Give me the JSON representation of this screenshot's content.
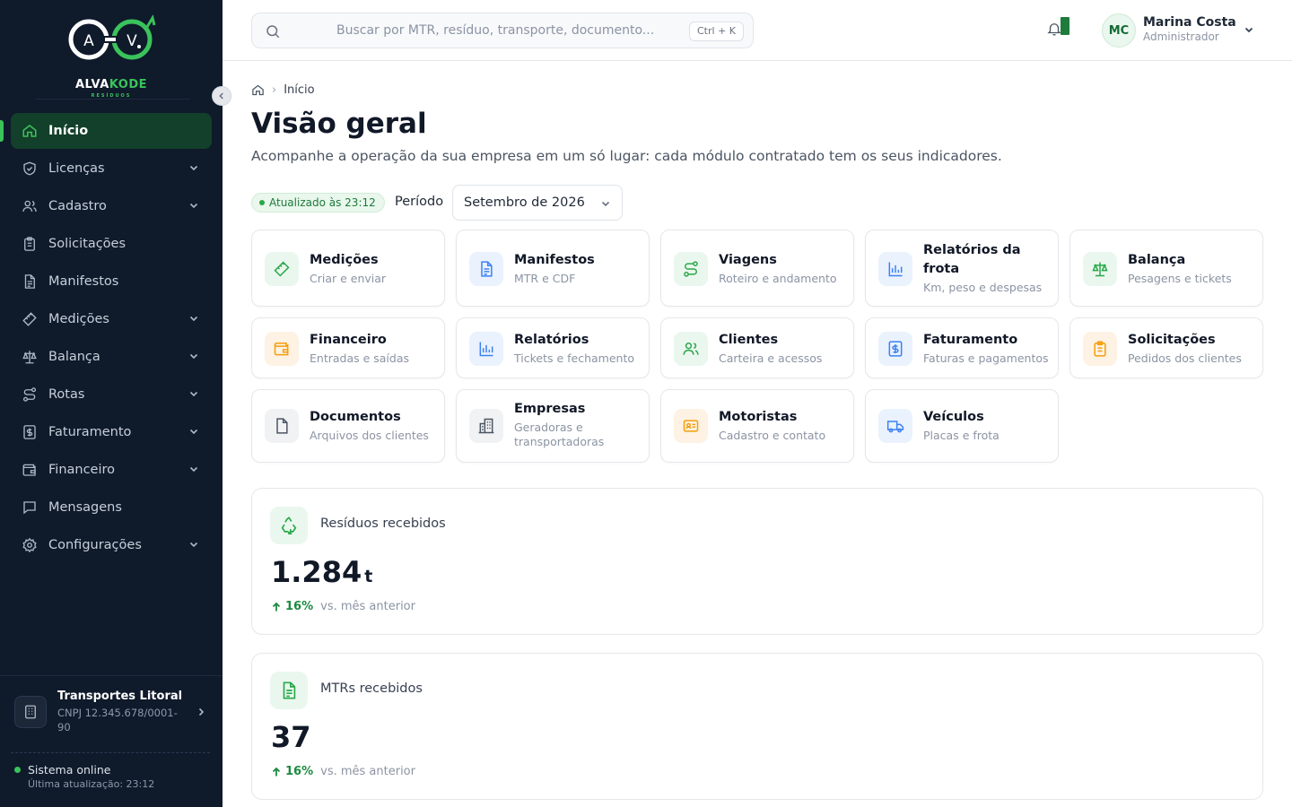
{
  "brand": {
    "name_part1": "ALVA",
    "name_part2": "KODE",
    "sub": "RESÍDUOS",
    "accent": "#3ac35a"
  },
  "sidebar": {
    "items": [
      {
        "label": "Início",
        "icon": "home-icon",
        "active": true,
        "has_children": false
      },
      {
        "label": "Licenças",
        "icon": "shield-icon",
        "has_children": true
      },
      {
        "label": "Cadastro",
        "icon": "users-icon",
        "has_children": true
      },
      {
        "label": "Solicitações",
        "icon": "clipboard-icon",
        "has_children": false
      },
      {
        "label": "Manifestos",
        "icon": "document-icon",
        "has_children": false
      },
      {
        "label": "Medições",
        "icon": "ruler-icon",
        "has_children": true
      },
      {
        "label": "Balança",
        "icon": "scale-icon",
        "has_children": true
      },
      {
        "label": "Rotas",
        "icon": "route-icon",
        "has_children": true
      },
      {
        "label": "Faturamento",
        "icon": "invoice-icon",
        "has_children": true
      },
      {
        "label": "Financeiro",
        "icon": "wallet-icon",
        "has_children": true
      },
      {
        "label": "Mensagens",
        "icon": "message-icon",
        "has_children": false
      },
      {
        "label": "Configurações",
        "icon": "gear-icon",
        "has_children": true
      }
    ],
    "company": {
      "name": "Transportes Litoral",
      "cnpj": "CNPJ 12.345.678/0001-90"
    },
    "status": {
      "label": "Sistema online",
      "sub": "Última atualização: 23:12"
    }
  },
  "topbar": {
    "search_placeholder": "Buscar por MTR, resíduo, transporte, documento...",
    "shortcut": "Ctrl + K",
    "user": {
      "initials": "MC",
      "name": "Marina Costa",
      "role": "Administrador"
    }
  },
  "main": {
    "breadcrumb": "Início",
    "title": "Visão geral",
    "subtitle": "Acompanhe a operação da sua empresa em um só lugar: cada módulo contratado tem os seus indicadores.",
    "updated": "Atualizado às 23:12",
    "period_label": "Período",
    "period_value": "Setembro de 2026",
    "modules": [
      {
        "title": "Medições",
        "sub": "Criar e enviar",
        "icon": "ruler-icon",
        "color": "green"
      },
      {
        "title": "Manifestos",
        "sub": "MTR e CDF",
        "icon": "document-icon",
        "color": "blue"
      },
      {
        "title": "Viagens",
        "sub": "Roteiro e andamento",
        "icon": "route-icon",
        "color": "green"
      },
      {
        "title": "Relatórios da frota",
        "sub": "Km, peso e despesas",
        "icon": "bar-chart-icon",
        "color": "blue"
      },
      {
        "title": "Balança",
        "sub": "Pesagens e tickets",
        "icon": "scale-icon",
        "color": "green"
      },
      {
        "title": "Financeiro",
        "sub": "Entradas e saídas",
        "icon": "wallet-icon",
        "color": "orange"
      },
      {
        "title": "Relatórios",
        "sub": "Tickets e fechamento",
        "icon": "bar-chart-icon",
        "color": "blue"
      },
      {
        "title": "Clientes",
        "sub": "Carteira e acessos",
        "icon": "users-icon",
        "color": "green"
      },
      {
        "title": "Faturamento",
        "sub": "Faturas e pagamentos",
        "icon": "invoice-icon",
        "color": "blue"
      },
      {
        "title": "Solicitações",
        "sub": "Pedidos dos clientes",
        "icon": "clipboard-icon",
        "color": "orange"
      },
      {
        "title": "Documentos",
        "sub": "Arquivos dos clientes",
        "icon": "file-icon",
        "color": "gray"
      },
      {
        "title": "Empresas",
        "sub": "Geradoras e transportadoras",
        "icon": "building-icon",
        "color": "gray"
      },
      {
        "title": "Motoristas",
        "sub": "Cadastro e contato",
        "icon": "id-card-icon",
        "color": "orange"
      },
      {
        "title": "Veículos",
        "sub": "Placas e frota",
        "icon": "truck-icon",
        "color": "blue"
      }
    ],
    "stats": [
      {
        "label": "Resíduos recebidos",
        "value": "1.284",
        "unit": "t",
        "trend": "16%",
        "vs": "vs. mês anterior",
        "icon": "recycle-icon"
      },
      {
        "label": "MTRs recebidos",
        "value": "37",
        "unit": "",
        "trend": "16%",
        "vs": "vs. mês anterior",
        "icon": "document-icon"
      }
    ]
  }
}
